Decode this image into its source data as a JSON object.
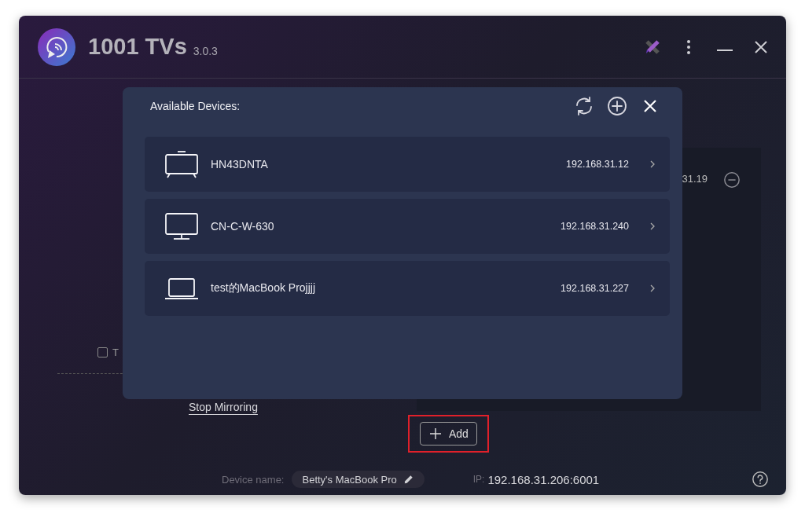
{
  "app": {
    "title": "1001 TVs",
    "version": "3.0.3"
  },
  "background": {
    "checkbox": {
      "label": "T",
      "checked": false
    },
    "connected_ip": "31.19",
    "stop_link": "Stop Mirroring",
    "add_button": "Add",
    "add_highlighted": true
  },
  "dialog": {
    "title": "Available Devices:",
    "devices": [
      {
        "kind": "tv",
        "name": "HN43DNTA",
        "ip": "192.168.31.12"
      },
      {
        "kind": "monitor",
        "name": "CN-C-W-630",
        "ip": "192.168.31.240"
      },
      {
        "kind": "laptop",
        "name": "test的MacBook Projjjj",
        "ip": "192.168.31.227"
      }
    ]
  },
  "footer": {
    "device_label": "Device name:",
    "device_name": "Betty's MacBook Pro",
    "ip_label": "IP:",
    "ip": "192.168.31.206:6001"
  }
}
